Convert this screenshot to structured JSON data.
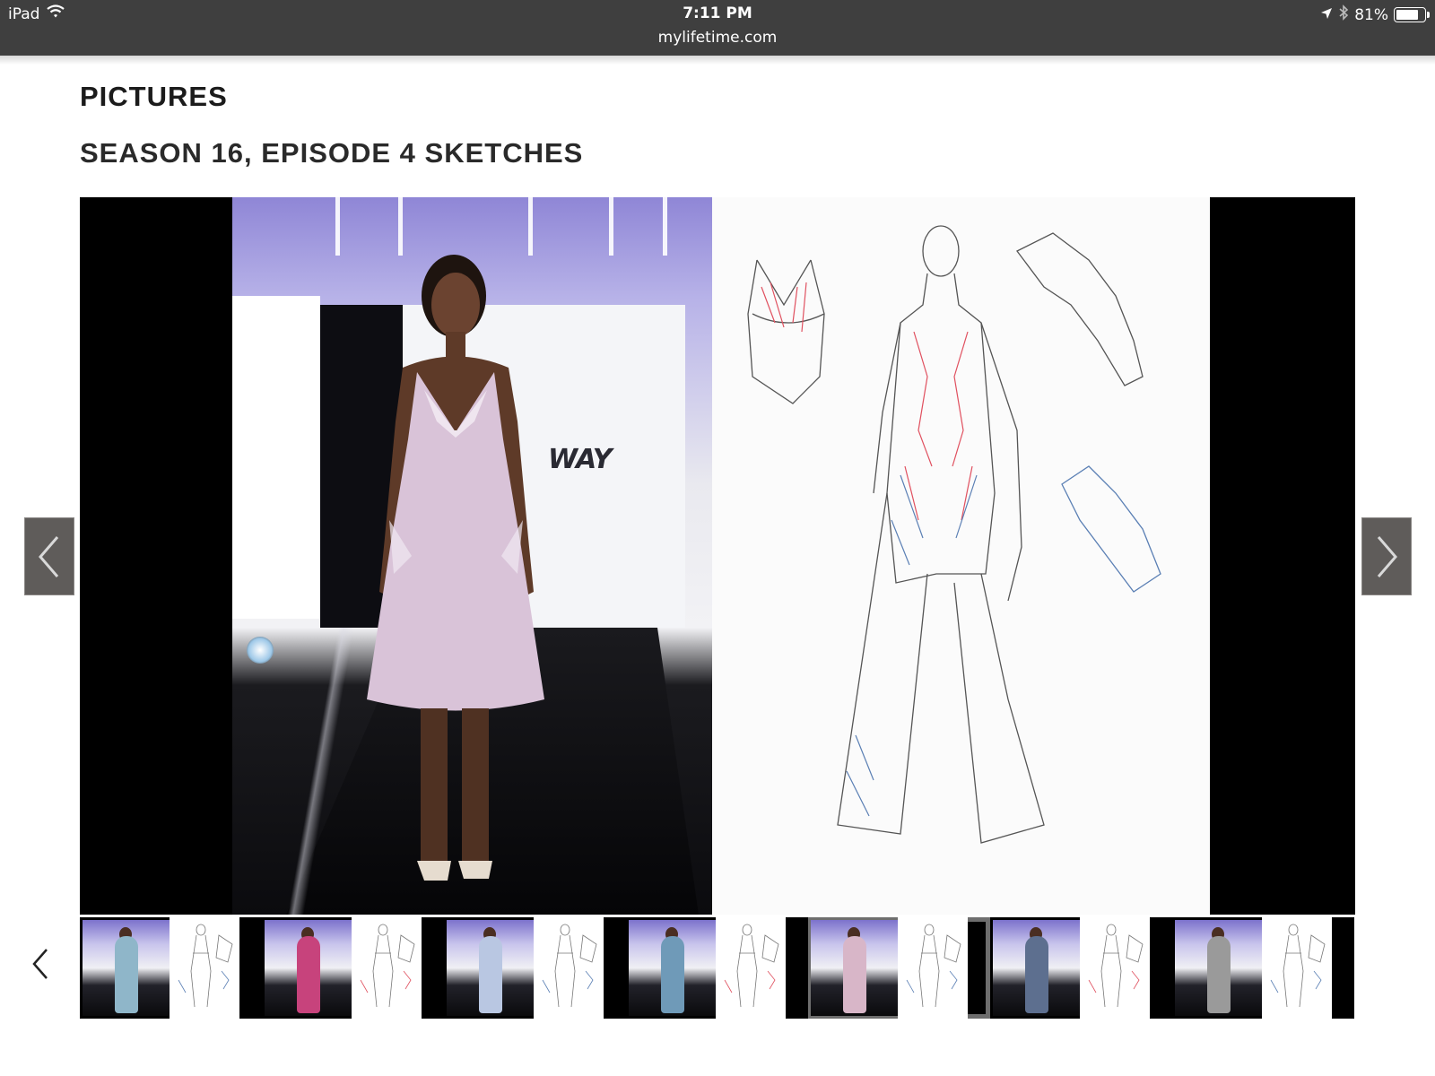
{
  "status_bar": {
    "device": "iPad",
    "time": "7:11 PM",
    "url": "mylifetime.com",
    "battery": "81%",
    "battery_level": 0.81
  },
  "page": {
    "section_title": "PICTURES",
    "gallery_title": "SEASON 16, EPISODE 4 SKETCHES",
    "runway_logo": "WAY"
  },
  "thumbnails": [
    {
      "dress_color": "#8fb6c9",
      "active": false
    },
    {
      "dress_color": "#c7437c",
      "active": false
    },
    {
      "dress_color": "#b9c7e2",
      "active": false
    },
    {
      "dress_color": "#6f9ab8",
      "active": false
    },
    {
      "dress_color": "#d8b6c8",
      "active": true
    },
    {
      "dress_color": "#5d6f8f",
      "active": false
    },
    {
      "dress_color": "#9a9a9a",
      "active": false
    }
  ],
  "colors": {
    "status_bar_bg": "#3f3f3f",
    "nav_button_bg": "#5f5c5a",
    "dress": "#d9c3d8",
    "sketch_red": "#e0505f",
    "sketch_blue": "#5a7fb4"
  }
}
